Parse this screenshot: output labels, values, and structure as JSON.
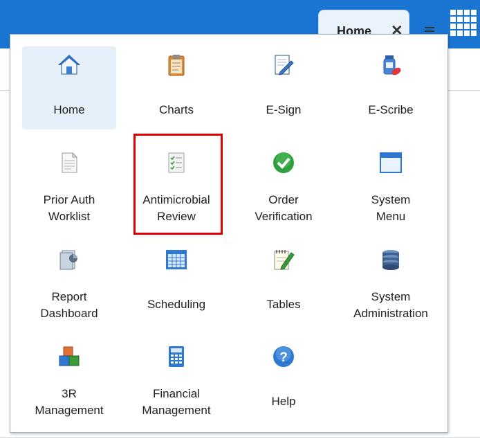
{
  "header": {
    "tab_label": "Home",
    "tab_close": "✕",
    "brand_color": "#1a75d2"
  },
  "menu": {
    "items": [
      {
        "line1": "Home",
        "line2": "",
        "icon": "home-icon",
        "selected": true
      },
      {
        "line1": "Charts",
        "line2": "",
        "icon": "clipboard-icon"
      },
      {
        "line1": "E-Sign",
        "line2": "",
        "icon": "pencil-document-icon"
      },
      {
        "line1": "E-Scribe",
        "line2": "",
        "icon": "medical-bottle-icon"
      },
      {
        "line1": "Prior Auth",
        "line2": "Worklist",
        "icon": "document-icon"
      },
      {
        "line1": "Antimicrobial",
        "line2": "Review",
        "icon": "checklist-icon",
        "highlighted": true
      },
      {
        "line1": "Order",
        "line2": "Verification",
        "icon": "checkmark-circle-icon"
      },
      {
        "line1": "System",
        "line2": "Menu",
        "icon": "window-icon"
      },
      {
        "line1": "Report",
        "line2": "Dashboard",
        "icon": "report-dashboard-icon"
      },
      {
        "line1": "Scheduling",
        "line2": "",
        "icon": "calendar-grid-icon"
      },
      {
        "line1": "Tables",
        "line2": "",
        "icon": "notepad-pencil-icon"
      },
      {
        "line1": "System",
        "line2": "Administration",
        "icon": "server-stack-icon"
      },
      {
        "line1": "3R",
        "line2": "Management",
        "icon": "blocks-icon"
      },
      {
        "line1": "Financial",
        "line2": "Management",
        "icon": "calculator-icon"
      },
      {
        "line1": "Help",
        "line2": "",
        "icon": "help-icon"
      }
    ]
  }
}
